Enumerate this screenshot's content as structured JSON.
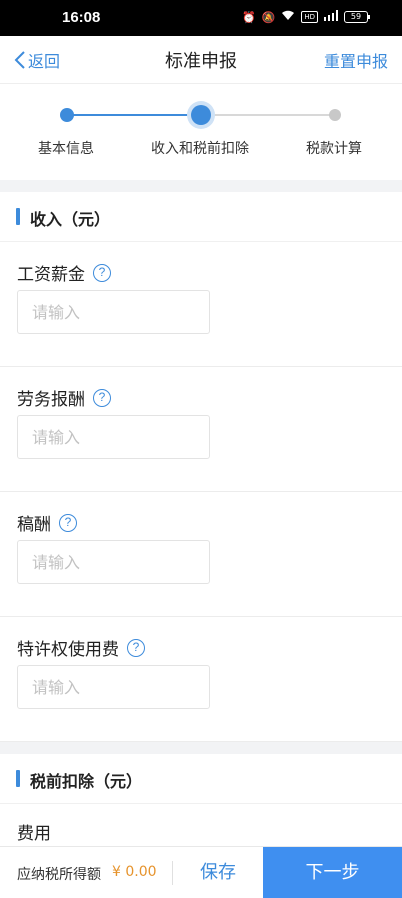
{
  "status_bar": {
    "time": "16:08",
    "battery": "59",
    "hd": "HD"
  },
  "nav": {
    "back_label": "返回",
    "title": "标准申报",
    "reset_label": "重置申报"
  },
  "steps": [
    {
      "label": "基本信息",
      "state": "done"
    },
    {
      "label": "收入和税前扣除",
      "state": "current"
    },
    {
      "label": "税款计算",
      "state": "pending"
    }
  ],
  "income_section": {
    "title": "收入（元）",
    "fields": [
      {
        "label": "工资薪金",
        "placeholder": "请输入",
        "value": ""
      },
      {
        "label": "劳务报酬",
        "placeholder": "请输入",
        "value": ""
      },
      {
        "label": "稿酬",
        "placeholder": "请输入",
        "value": ""
      },
      {
        "label": "特许权使用费",
        "placeholder": "请输入",
        "value": ""
      }
    ]
  },
  "deduction_section": {
    "title": "税前扣除（元）",
    "fee_label": "费用"
  },
  "bottom": {
    "taxable_label": "应纳税所得额",
    "taxable_value": "¥ 0.00",
    "save_label": "保存",
    "next_label": "下一步"
  },
  "colors": {
    "accent": "#3d8bdb",
    "next_button": "#3f8ff0",
    "amount": "#e6932c"
  }
}
